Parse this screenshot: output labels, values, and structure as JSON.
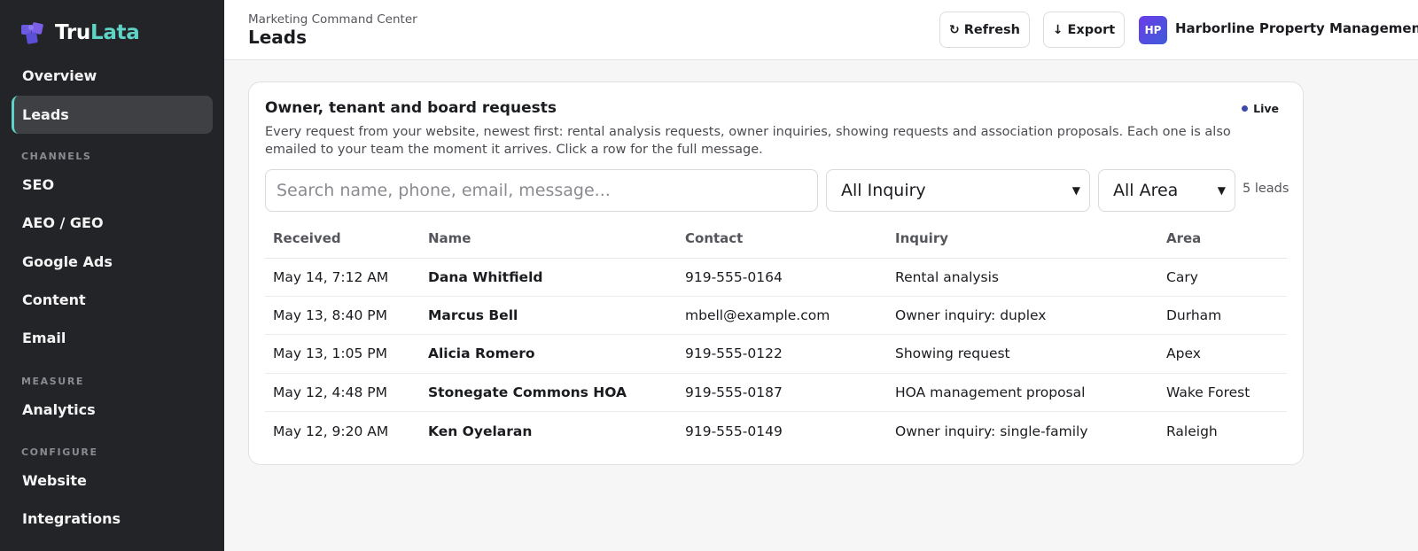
{
  "brand": {
    "name_part1": "Tru",
    "name_part2": "Lata",
    "icon": "puzzle-logo-icon"
  },
  "sidebar": {
    "overview": "Overview",
    "leads": "Leads",
    "channels_heading": "CHANNELS",
    "seo": "SEO",
    "aeo_geo": "AEO / GEO",
    "google_ads": "Google Ads",
    "content": "Content",
    "email": "Email",
    "measure_heading": "MEASURE",
    "analytics": "Analytics",
    "configure_heading": "CONFIGURE",
    "website": "Website",
    "integrations": "Integrations"
  },
  "header": {
    "breadcrumb": "Marketing Command Center",
    "title": "Leads",
    "refresh_label": "Refresh",
    "refresh_icon": "refresh-icon",
    "export_label": "Export",
    "export_icon": "arrow-down-icon",
    "org_initials": "HP",
    "org_name": "Harborline Property Management"
  },
  "card": {
    "title": "Owner, tenant and board requests",
    "live_label": "Live",
    "description": "Every request from your website, newest first: rental analysis requests, owner inquiries, showing requests and association proposals. Each one is also emailed to your team the moment it arrives. Click a row for the full message.",
    "search_placeholder": "Search name, phone, email, message...",
    "inquiry_filter": "All Inquiry",
    "area_filter": "All Area",
    "lead_count": "5 leads"
  },
  "table": {
    "columns": [
      "Received",
      "Name",
      "Contact",
      "Inquiry",
      "Area"
    ],
    "rows": [
      {
        "received": "May 14, 7:12 AM",
        "name": "Dana Whitfield",
        "contact": "919-555-0164",
        "inquiry": "Rental analysis",
        "area": "Cary"
      },
      {
        "received": "May 13, 8:40 PM",
        "name": "Marcus Bell",
        "contact": "mbell@example.com",
        "inquiry": "Owner inquiry: duplex",
        "area": "Durham"
      },
      {
        "received": "May 13, 1:05 PM",
        "name": "Alicia Romero",
        "contact": "919-555-0122",
        "inquiry": "Showing request",
        "area": "Apex"
      },
      {
        "received": "May 12, 4:48 PM",
        "name": "Stonegate Commons HOA",
        "contact": "919-555-0187",
        "inquiry": "HOA management proposal",
        "area": "Wake Forest"
      },
      {
        "received": "May 12, 9:20 AM",
        "name": "Ken Oyelaran",
        "contact": "919-555-0149",
        "inquiry": "Owner inquiry: single-family",
        "area": "Raleigh"
      }
    ]
  },
  "colors": {
    "sidebar_bg": "#232427",
    "accent": "#5fd3c6",
    "live_dot": "#3d4aa8",
    "avatar_gradient_start": "#6a3de8",
    "avatar_gradient_end": "#3f5bd8"
  }
}
